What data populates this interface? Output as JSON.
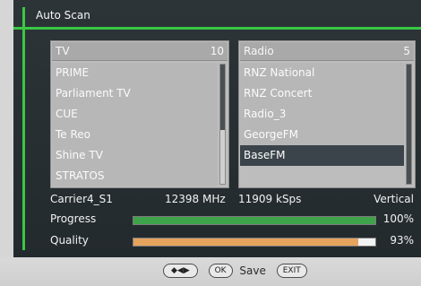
{
  "title": "Auto Scan",
  "tv": {
    "label": "TV",
    "count": "10",
    "items": [
      "PRIME",
      "Parliament TV",
      "CUE",
      "Te Reo",
      "Shine TV",
      "STRATOS"
    ],
    "selected_index": -1,
    "scroll_fraction": 0.55
  },
  "radio": {
    "label": "Radio",
    "count": "5",
    "items": [
      "RNZ National",
      "RNZ Concert",
      "Radio_3",
      "GeorgeFM",
      "BaseFM"
    ],
    "selected_index": 4,
    "scroll_fraction": 1.0
  },
  "info": {
    "carrier": "Carrier4_S1",
    "frequency": "12398 MHz",
    "symbol_rate": "11909 kSps",
    "polarization": "Vertical"
  },
  "progress": {
    "label": "Progress",
    "value_percent": 100,
    "text": "100%"
  },
  "quality": {
    "label": "Quality",
    "value_percent": 93,
    "text": "93%"
  },
  "footer": {
    "nav_key_icon": "arrow-keys-icon",
    "ok_key_label": "OK",
    "ok_action": "Save",
    "exit_key_label": "EXIT"
  },
  "colors": {
    "frame_green": "#39c844",
    "progress_green": "#3ea34a",
    "quality_orange": "#e6a35e"
  }
}
